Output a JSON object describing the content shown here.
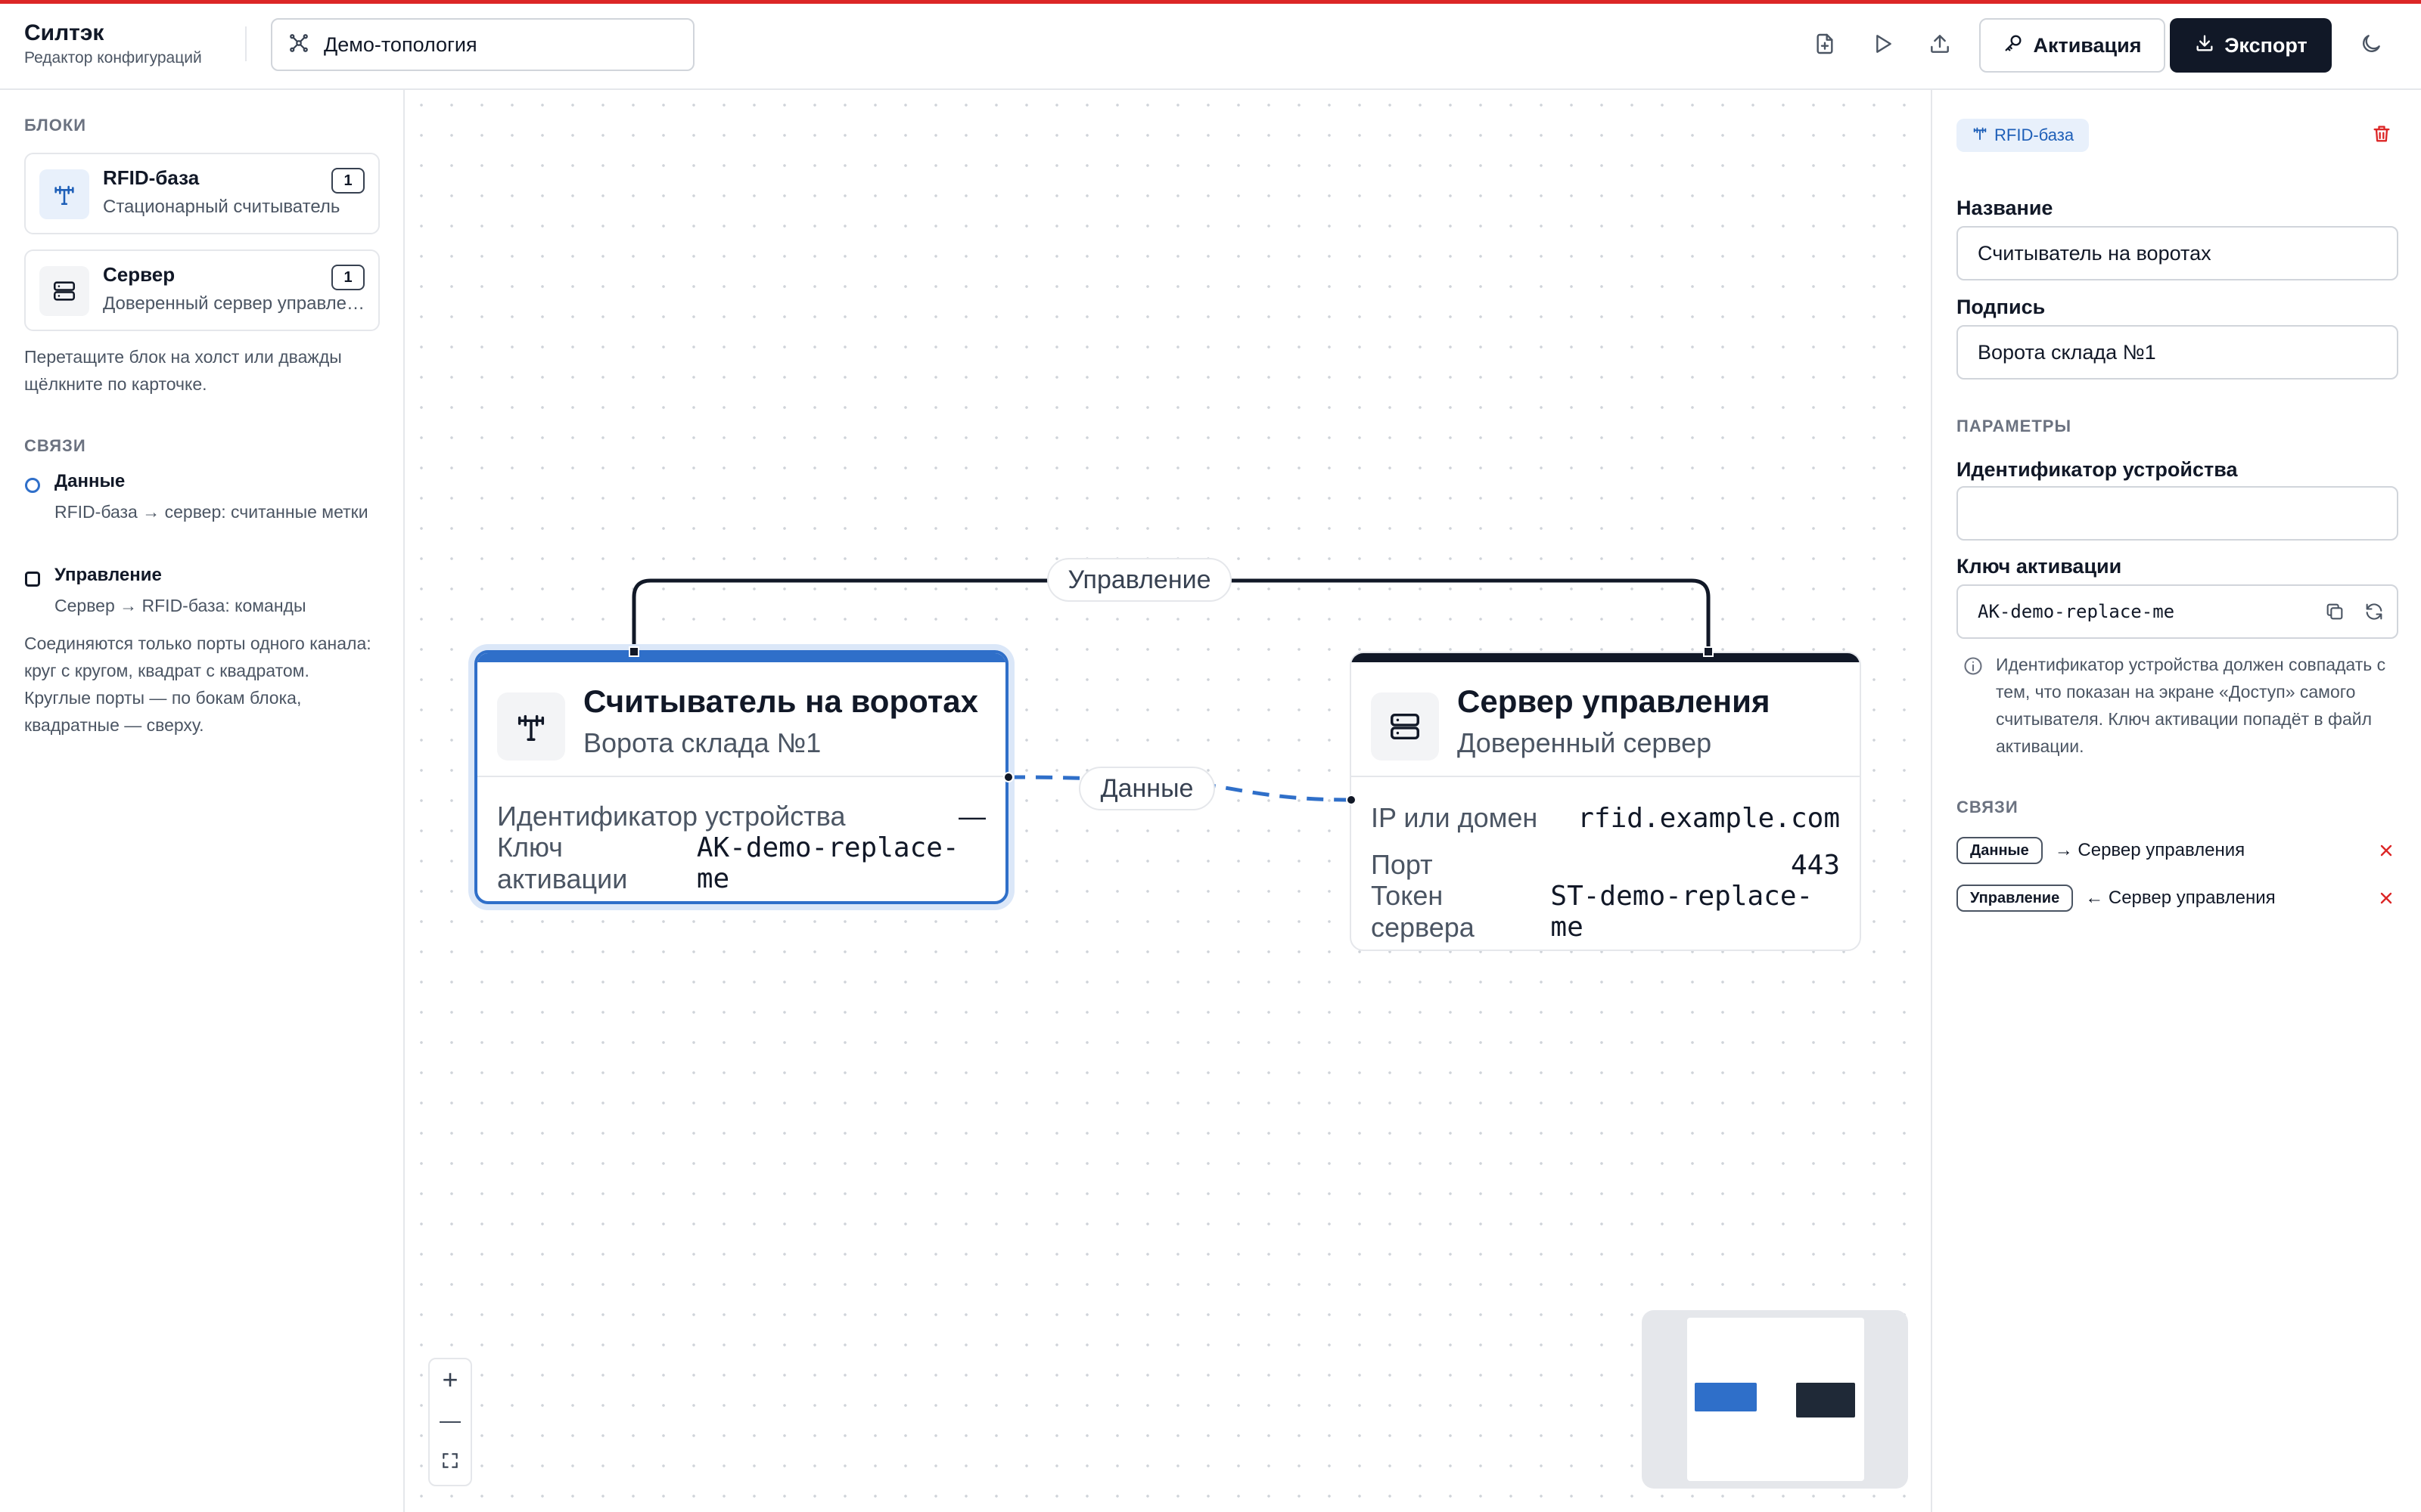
{
  "app": {
    "name": "Силтэк",
    "subtitle": "Редактор конфигураций",
    "project": "Демо-топология"
  },
  "toolbar": {
    "new_icon": "file-plus-icon",
    "run_icon": "play-icon",
    "upload_icon": "upload-icon",
    "activate_label": "Активация",
    "export_label": "Экспорт",
    "theme_icon": "moon-icon"
  },
  "sidebar": {
    "blocks_title": "БЛОКИ",
    "blocks": [
      {
        "name": "RFID-база",
        "desc": "Стационарный считыватель",
        "count": "1",
        "icon": "antenna-icon"
      },
      {
        "name": "Сервер",
        "desc": "Доверенный сервер управления",
        "count": "1",
        "icon": "server-icon"
      }
    ],
    "blocks_hint": "Перетащите блок на холст или дважды щёлкните по карточке.",
    "links_title": "СВЯЗИ",
    "links": [
      {
        "name": "Данные",
        "desc": "RFID-база → сервер: считанные метки",
        "marker": "circle"
      },
      {
        "name": "Управление",
        "desc": "Сервер → RFID-база: команды",
        "marker": "square"
      }
    ],
    "links_hint": "Соединяются только порты одного канала: круг с кругом, квадрат с квадратом. Круглые порты — по бокам блока, квадратные — сверху."
  },
  "canvas": {
    "edges": [
      {
        "label": "Управление",
        "style": "solid"
      },
      {
        "label": "Данные",
        "style": "dashed"
      }
    ],
    "nodes": [
      {
        "title": "Считыватель на воротах",
        "subtitle": "Ворота склада №1",
        "selected": true,
        "rows": [
          {
            "key": "Идентификатор устройства",
            "value": "—"
          },
          {
            "key": "Ключ активации",
            "value": "AK-demo-replace-me"
          }
        ]
      },
      {
        "title": "Сервер управления",
        "subtitle": "Доверенный сервер",
        "selected": false,
        "rows": [
          {
            "key": "IP или домен",
            "value": "rfid.example.com"
          },
          {
            "key": "Порт",
            "value": "443"
          },
          {
            "key": "Токен сервера",
            "value": "ST-demo-replace-me"
          }
        ]
      }
    ],
    "zoom_in": "+",
    "zoom_out": "—",
    "fit_icon": "fit-view-icon"
  },
  "inspector": {
    "type_badge": "RFID-база",
    "name_label": "Название",
    "name_value": "Считыватель на воротах",
    "caption_label": "Подпись",
    "caption_value": "Ворота склада №1",
    "params_title": "ПАРАМЕТРЫ",
    "device_id_label": "Идентификатор устройства",
    "device_id_value": "",
    "key_label": "Ключ активации",
    "key_value": "AK-demo-replace-me",
    "info_text": "Идентификатор устройства должен совпадать с тем, что показан на экране «Доступ» самого считывателя. Ключ активации попадёт в файл активации.",
    "links_title": "СВЯЗИ",
    "links": [
      {
        "chip": "Данные",
        "target": "→ Сервер управления"
      },
      {
        "chip": "Управление",
        "target": "← Сервер управления"
      }
    ]
  },
  "colors": {
    "accent": "#2f6fc9",
    "dark": "#111827",
    "danger": "#dc2626",
    "top_line": "#dc2626"
  }
}
